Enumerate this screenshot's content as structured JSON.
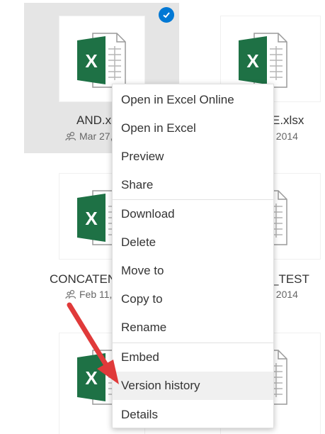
{
  "files": [
    {
      "name": "AND.x",
      "meta": "Mar 27,"
    },
    {
      "name": "E.xlsx",
      "meta": ", 2014"
    },
    {
      "name": "CONCATEN",
      "meta": "Feb 11,"
    },
    {
      "name": "_TEST",
      "meta": ", 2014"
    }
  ],
  "context_menu": {
    "items": [
      {
        "label": "Open in Excel Online"
      },
      {
        "label": "Open in Excel"
      },
      {
        "label": "Preview"
      },
      {
        "label": "Share"
      },
      {
        "label": "Download"
      },
      {
        "label": "Delete"
      },
      {
        "label": "Move to"
      },
      {
        "label": "Copy to"
      },
      {
        "label": "Rename"
      },
      {
        "label": "Embed"
      },
      {
        "label": "Version history"
      },
      {
        "label": "Details"
      }
    ],
    "hovered_item": "Version history"
  },
  "icons": {
    "file_type": "excel-file-icon",
    "shared": "shared-people-icon",
    "selected": "checkmark-icon",
    "annotation": "red-arrow"
  },
  "colors": {
    "excel_green": "#1e7145",
    "selection_blue": "#0078d4",
    "arrow_red": "#e03a3a"
  }
}
